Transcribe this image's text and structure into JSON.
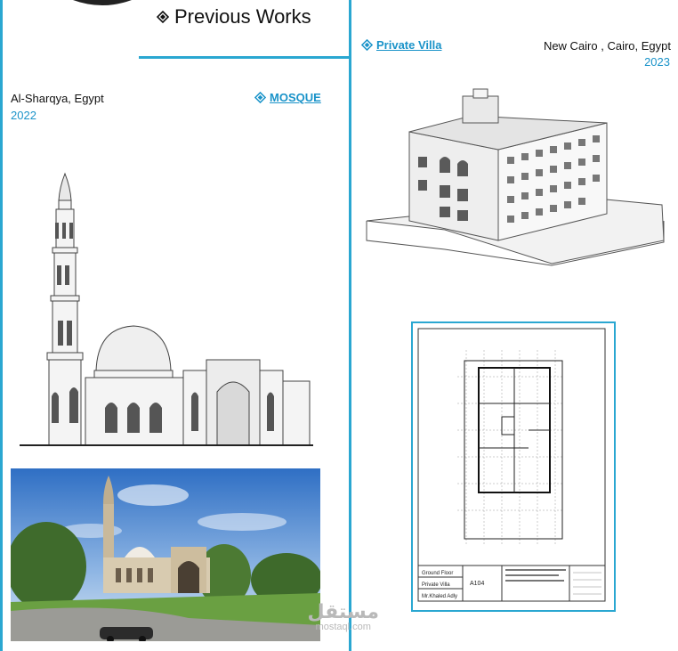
{
  "header": {
    "title": "Previous Works"
  },
  "mosque": {
    "location": "Al-Sharqya, Egypt",
    "year": "2022",
    "link_label": "MOSQUE"
  },
  "villa": {
    "link_label": "Private Villa",
    "location": "New Cairo , Cairo, Egypt",
    "year": "2023"
  },
  "plan_sheet": {
    "title_block": {
      "sheet_name": "Ground Floor",
      "project": "Private Villa",
      "owner": "Mr.Khaled Adly",
      "sheet_number": "A104"
    }
  },
  "watermark": {
    "arabic": "مستقل",
    "latin": "mostaql.com"
  },
  "colors": {
    "accent": "#2aa7d1",
    "link": "#1a93c9"
  }
}
